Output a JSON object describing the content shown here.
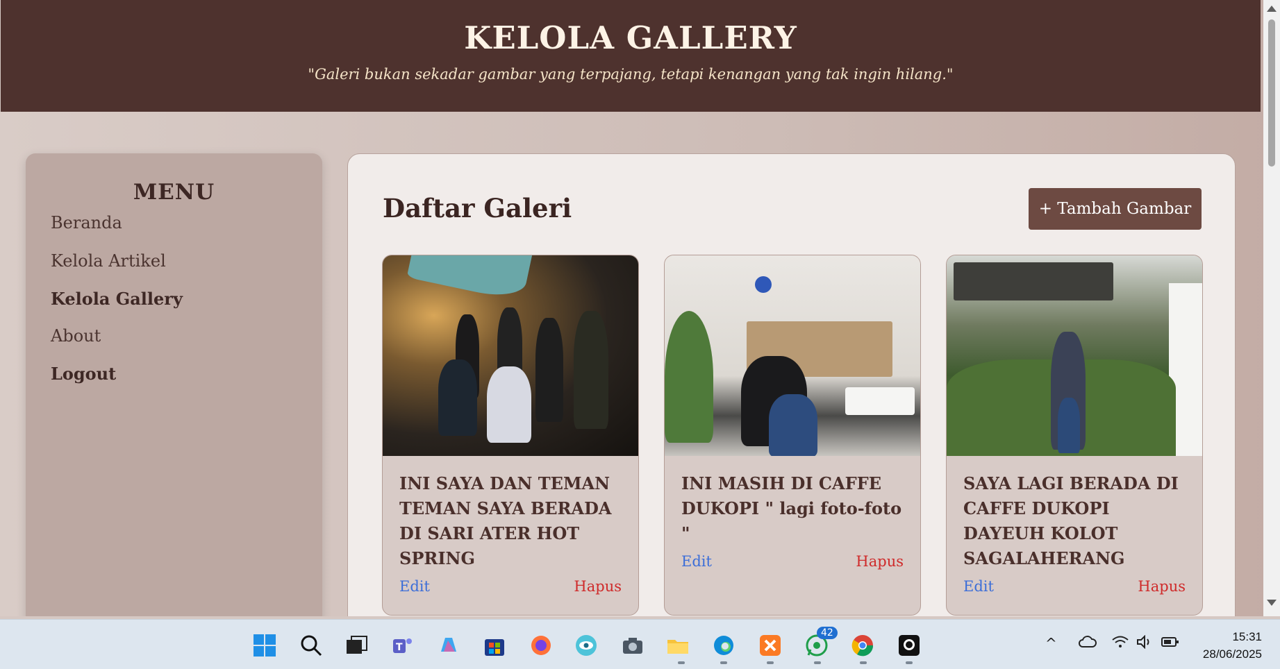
{
  "header": {
    "title": "KELOLA GALLERY",
    "quote": "\"Galeri bukan sekadar gambar yang terpajang, tetapi kenangan yang tak ingin hilang.\""
  },
  "sidebar": {
    "heading": "MENU",
    "items": [
      {
        "label": "Beranda"
      },
      {
        "label": "Kelola Artikel"
      },
      {
        "label": "Kelola Gallery"
      },
      {
        "label": "About"
      },
      {
        "label": "Logout"
      }
    ]
  },
  "main": {
    "title": "Daftar Galeri",
    "add_button": "+ Tambah Gambar",
    "cards": [
      {
        "title": "INI SAYA DAN TEMAN TEMAN SAYA BERADA DI SARI ATER HOT SPRING",
        "edit": "Edit",
        "delete": "Hapus"
      },
      {
        "title": "INI MASIH DI CAFFE DUKOPI \" lagi foto-foto \"",
        "edit": "Edit",
        "delete": "Hapus"
      },
      {
        "title": "SAYA LAGI BERADA DI CAFFE DUKOPI DAYEUH KOLOT SAGALAHERANG",
        "edit": "Edit",
        "delete": "Hapus"
      }
    ]
  },
  "taskbar": {
    "whatsapp_badge": "42",
    "time": "15:31",
    "date": "28/06/2025",
    "icons": [
      "windows-start-icon",
      "search-icon",
      "task-view-icon",
      "teams-icon",
      "copilot-icon",
      "store-icon",
      "firefox-icon",
      "eye-icon",
      "camera-icon",
      "file-explorer-icon",
      "edge-icon",
      "xampp-icon",
      "whatsapp-icon",
      "chrome-icon",
      "github-icon"
    ]
  },
  "colors": {
    "header_bg": "#4e322e",
    "accent_button": "#6d4a42",
    "edit_link": "#3c6ed8",
    "delete_link": "#cf2a2a"
  }
}
